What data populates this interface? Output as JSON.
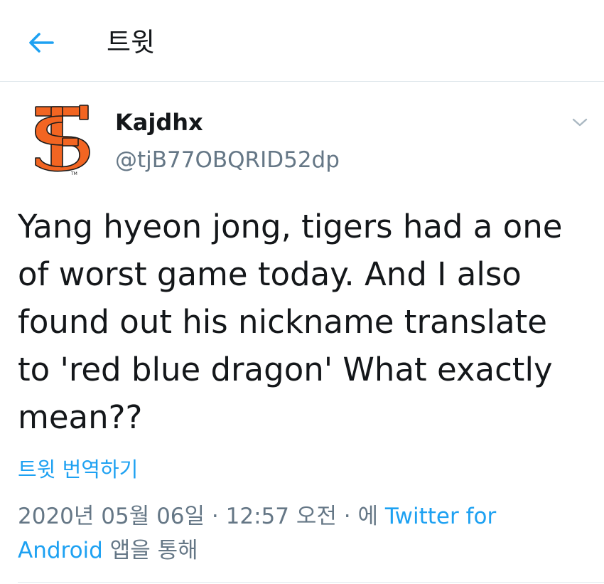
{
  "header": {
    "back_icon": "arrow-left-icon",
    "title": "트윗"
  },
  "tweet": {
    "author": {
      "display_name": "Kajdhx",
      "handle": "@tjB77OBQRID52dp",
      "avatar_icon": "sf-giants-logo",
      "avatar_mark": "TM"
    },
    "menu_icon": "chevron-down-icon",
    "text": "Yang hyeon jong, tigers had a one of worst game today. And I also found out his nickname translate to 'red blue dragon' What exactly mean??",
    "translate_label": "트윗 번역하기",
    "date": "2020년 05월 06일",
    "separator": "·",
    "time": "12:57 오전",
    "via_prefix": "에",
    "source": "Twitter for Android",
    "via_suffix": "앱을 통해"
  },
  "colors": {
    "accent": "#1da1f2",
    "text": "#14171a",
    "secondary": "#657786",
    "divider": "#e1e8ed",
    "avatar_orange": "#f26522"
  }
}
